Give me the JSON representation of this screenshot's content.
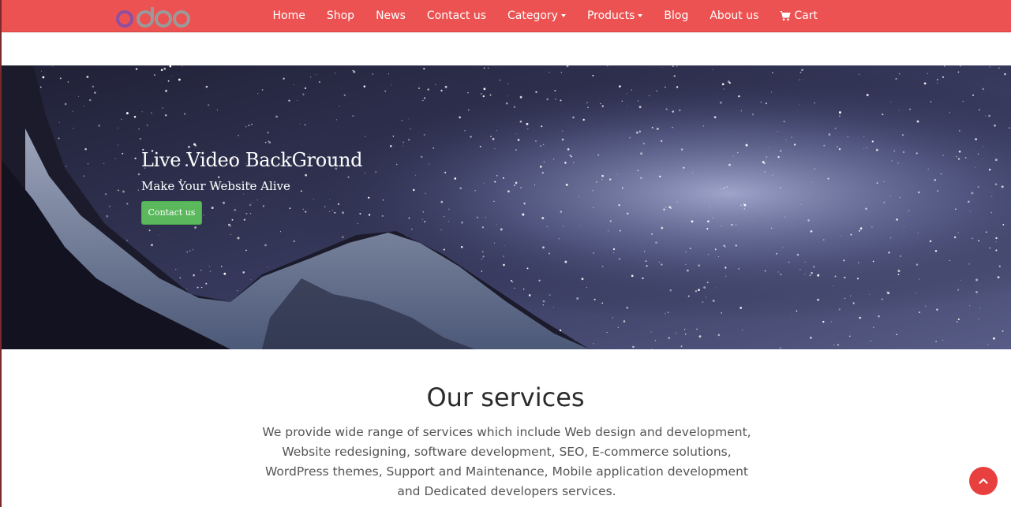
{
  "brand": {
    "logo_text": "odoo",
    "colors": {
      "navbar": "#ec5251",
      "logo_o1": "#8e4fa0",
      "logo_rest": "#9a9a9a",
      "button": "#5cb85c"
    }
  },
  "nav": {
    "items": [
      {
        "label": "Home",
        "dropdown": false
      },
      {
        "label": "Shop",
        "dropdown": false
      },
      {
        "label": "News",
        "dropdown": false
      },
      {
        "label": "Contact us",
        "dropdown": false
      },
      {
        "label": "Category",
        "dropdown": true
      },
      {
        "label": "Products",
        "dropdown": true
      },
      {
        "label": "Blog",
        "dropdown": false
      },
      {
        "label": "About us",
        "dropdown": false
      }
    ],
    "cart": {
      "label": "Cart",
      "icon": "shopping-cart-icon"
    }
  },
  "hero": {
    "title": "Live Video BackGround",
    "subtitle": "Make Your Website Alive",
    "button_label": "Contact us"
  },
  "services": {
    "title": "Our services",
    "text": "We provide wide range of services which include Web design and development, Website redesigning, software development, SEO, E-commerce solutions, WordPress themes,  Support and Maintenance, Mobile application development and Dedicated developers services."
  },
  "scroll_top": {
    "icon": "chevron-up-icon"
  }
}
